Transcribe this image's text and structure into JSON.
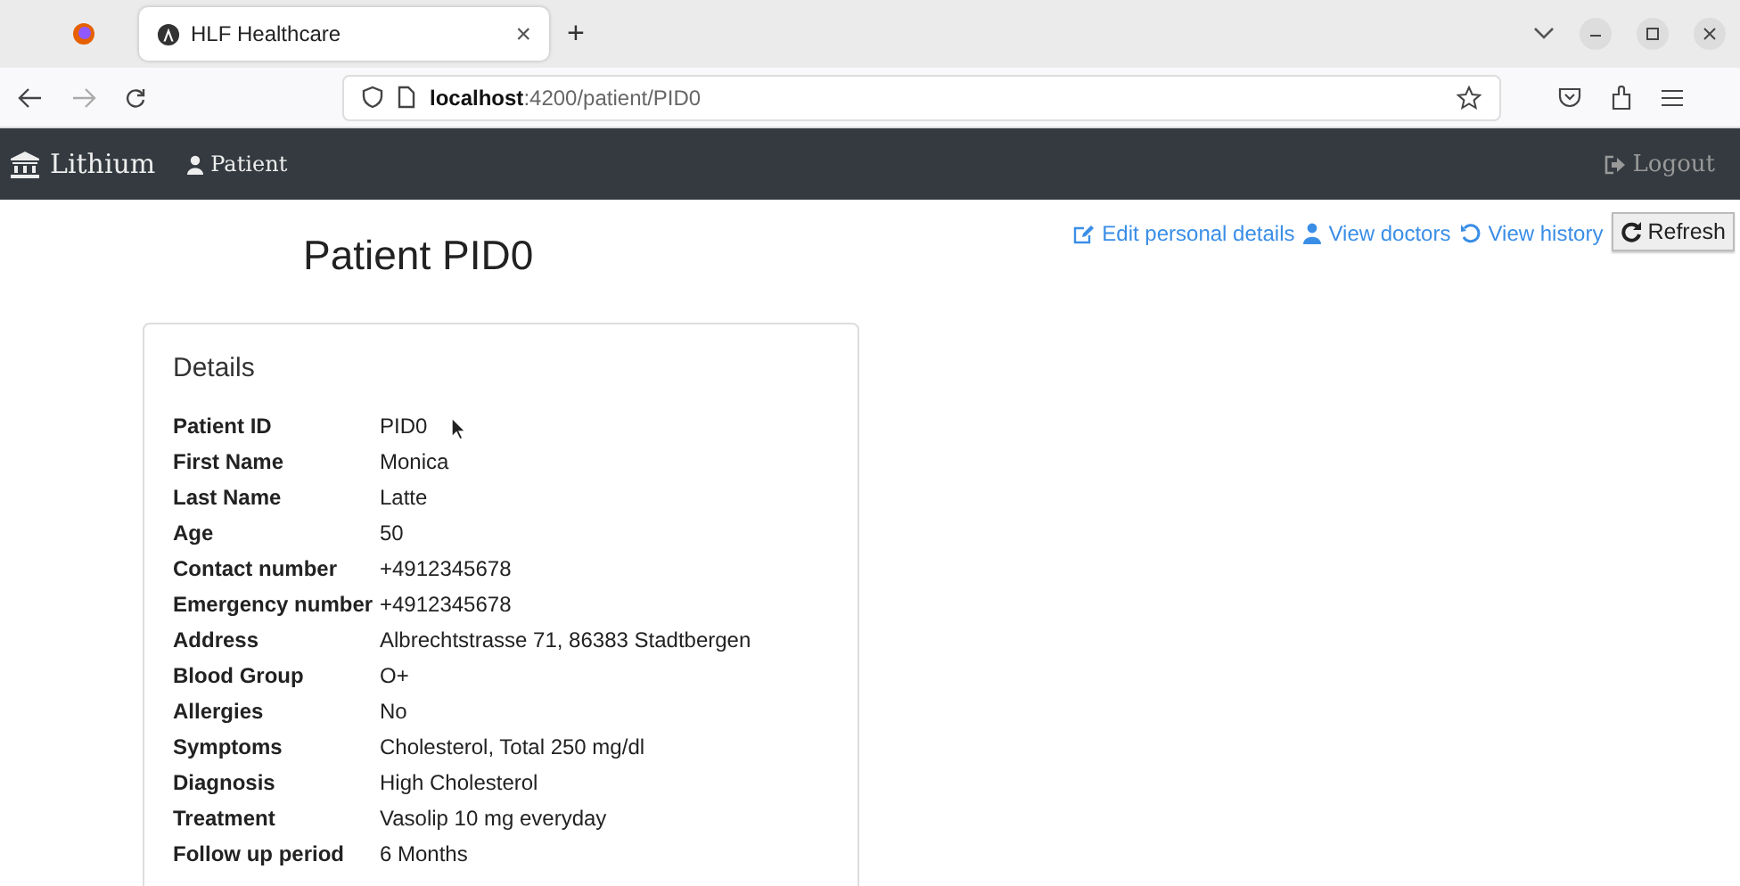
{
  "browser": {
    "tab": {
      "title": "HLF Healthcare",
      "close": "×",
      "selected": true
    },
    "new_tab": "+",
    "url": "**localhost**:4200/patient/PID0"
  },
  "navbar": {
    "brand": "Lithium",
    "items": [
      {
        "label": "Patient",
        "selected": true
      }
    ],
    "logout": "Logout"
  },
  "page": {
    "title": "Patient PID0",
    "actions": [
      {
        "kind": "edit",
        "label": "Edit personal details"
      },
      {
        "kind": "doctors",
        "label": "View doctors"
      },
      {
        "kind": "history",
        "label": "View history"
      }
    ],
    "refresh": "Refresh"
  },
  "details": {
    "title": "Details",
    "rows": [
      {
        "label": "Patient ID",
        "value": "PID0"
      },
      {
        "label": "First Name",
        "value": "Monica"
      },
      {
        "label": "Last Name",
        "value": "Latte"
      },
      {
        "label": "Age",
        "value": "50"
      },
      {
        "label": "Contact number",
        "value": "+4912345678"
      },
      {
        "label": "Emergency number",
        "value": "+4912345678"
      },
      {
        "label": "Address",
        "value": "Albrechtstrasse 71, 86383 Stadtbergen"
      },
      {
        "label": "Blood Group",
        "value": "O+"
      },
      {
        "label": "Allergies",
        "value": "No"
      },
      {
        "label": "Symptoms",
        "value": "Cholesterol, Total 250 mg/dl"
      },
      {
        "label": "Diagnosis",
        "value": "High Cholesterol"
      },
      {
        "label": "Treatment",
        "value": "Vasolip 10 mg everyday"
      },
      {
        "label": "Follow up period",
        "value": "6 Months"
      }
    ]
  }
}
